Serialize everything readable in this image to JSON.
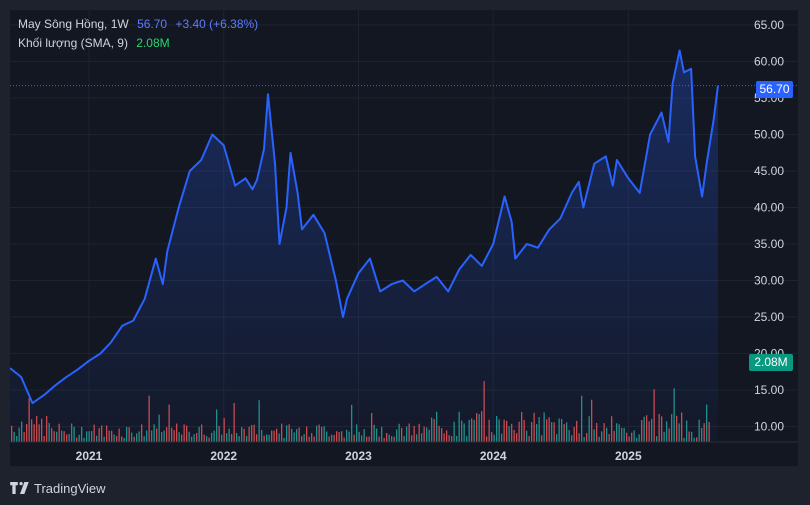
{
  "legend": {
    "symbol": "May Sông Hồng, 1W",
    "price": "56.70",
    "change": "+3.40 (+6.38%)",
    "volume_label": "Khối lượng (SMA, 9)",
    "volume_value": "2.08M"
  },
  "price_tag": "56.70",
  "volume_tag": "2.08M",
  "footer": {
    "brand": "TradingView",
    "logo_icon": "tradingview-logo-icon"
  },
  "colors": {
    "line": "#2962ff",
    "up_volume": "#26a69a",
    "down_volume": "#ef5350",
    "background": "#131722"
  },
  "chart_data": {
    "type": "line",
    "interval": "1W",
    "ylim": [
      7,
      67
    ],
    "y_ticks": [
      "10.00",
      "15.00",
      "20.00",
      "25.00",
      "30.00",
      "35.00",
      "40.00",
      "45.00",
      "50.00",
      "55.00",
      "60.00",
      "65.00"
    ],
    "x_ticks": [
      "2021",
      "2022",
      "2023",
      "2024",
      "2025"
    ],
    "series": [
      {
        "values": [
          {
            "x": "2020-06",
            "y": 18.0
          },
          {
            "x": "2020-07",
            "y": 16.8
          },
          {
            "x": "2020-08",
            "y": 13.2
          },
          {
            "x": "2020-09",
            "y": 14.3
          },
          {
            "x": "2020-10",
            "y": 15.6
          },
          {
            "x": "2020-11",
            "y": 16.8
          },
          {
            "x": "2020-12",
            "y": 17.8
          },
          {
            "x": "2021-01",
            "y": 19.0
          },
          {
            "x": "2021-02",
            "y": 20.0
          },
          {
            "x": "2021-03",
            "y": 21.5
          },
          {
            "x": "2021-04",
            "y": 23.8
          },
          {
            "x": "2021-05",
            "y": 24.5
          },
          {
            "x": "2021-06",
            "y": 27.5
          },
          {
            "x": "2021-07",
            "y": 33.0
          },
          {
            "x": "2021-07-20",
            "y": 29.5
          },
          {
            "x": "2021-08",
            "y": 34.0
          },
          {
            "x": "2021-09",
            "y": 40.0
          },
          {
            "x": "2021-10",
            "y": 45.0
          },
          {
            "x": "2021-11",
            "y": 46.5
          },
          {
            "x": "2021-12",
            "y": 50.0
          },
          {
            "x": "2022-01",
            "y": 48.5
          },
          {
            "x": "2022-02",
            "y": 43.0
          },
          {
            "x": "2022-03",
            "y": 44.0
          },
          {
            "x": "2022-03-20",
            "y": 42.5
          },
          {
            "x": "2022-04",
            "y": 43.8
          },
          {
            "x": "2022-04-20",
            "y": 48.0
          },
          {
            "x": "2022-05",
            "y": 55.5
          },
          {
            "x": "2022-05-20",
            "y": 46.0
          },
          {
            "x": "2022-06",
            "y": 35.0
          },
          {
            "x": "2022-06-20",
            "y": 40.0
          },
          {
            "x": "2022-07",
            "y": 47.5
          },
          {
            "x": "2022-07-20",
            "y": 42.0
          },
          {
            "x": "2022-08",
            "y": 37.0
          },
          {
            "x": "2022-09",
            "y": 39.0
          },
          {
            "x": "2022-10",
            "y": 36.5
          },
          {
            "x": "2022-11",
            "y": 30.0
          },
          {
            "x": "2022-11-20",
            "y": 25.0
          },
          {
            "x": "2022-12",
            "y": 27.5
          },
          {
            "x": "2023-01",
            "y": 31.0
          },
          {
            "x": "2023-02",
            "y": 33.0
          },
          {
            "x": "2023-03",
            "y": 28.5
          },
          {
            "x": "2023-04",
            "y": 29.5
          },
          {
            "x": "2023-05",
            "y": 30.0
          },
          {
            "x": "2023-06",
            "y": 28.5
          },
          {
            "x": "2023-07",
            "y": 29.5
          },
          {
            "x": "2023-08",
            "y": 30.5
          },
          {
            "x": "2023-09",
            "y": 28.5
          },
          {
            "x": "2023-10",
            "y": 31.5
          },
          {
            "x": "2023-11",
            "y": 33.5
          },
          {
            "x": "2023-12",
            "y": 32.0
          },
          {
            "x": "2024-01",
            "y": 35.0
          },
          {
            "x": "2024-01-20",
            "y": 39.0
          },
          {
            "x": "2024-02",
            "y": 41.5
          },
          {
            "x": "2024-02-20",
            "y": 38.0
          },
          {
            "x": "2024-03",
            "y": 33.0
          },
          {
            "x": "2024-04",
            "y": 35.0
          },
          {
            "x": "2024-05",
            "y": 34.5
          },
          {
            "x": "2024-06",
            "y": 37.0
          },
          {
            "x": "2024-07",
            "y": 38.5
          },
          {
            "x": "2024-08",
            "y": 42.0
          },
          {
            "x": "2024-08-20",
            "y": 43.5
          },
          {
            "x": "2024-09",
            "y": 40.0
          },
          {
            "x": "2024-10",
            "y": 46.0
          },
          {
            "x": "2024-11",
            "y": 47.0
          },
          {
            "x": "2024-11-20",
            "y": 43.0
          },
          {
            "x": "2024-12",
            "y": 46.5
          },
          {
            "x": "2025-01",
            "y": 44.0
          },
          {
            "x": "2025-02",
            "y": 42.0
          },
          {
            "x": "2025-03",
            "y": 50.0
          },
          {
            "x": "2025-04",
            "y": 53.0
          },
          {
            "x": "2025-04-20",
            "y": 49.0
          },
          {
            "x": "2025-05",
            "y": 57.0
          },
          {
            "x": "2025-05-20",
            "y": 61.5
          },
          {
            "x": "2025-06",
            "y": 58.5
          },
          {
            "x": "2025-06-20",
            "y": 59.0
          },
          {
            "x": "2025-07",
            "y": 47.0
          },
          {
            "x": "2025-07-20",
            "y": 41.5
          },
          {
            "x": "2025-08",
            "y": 46.0
          },
          {
            "x": "2025-08-20",
            "y": 52.0
          },
          {
            "x": "2025-09",
            "y": 56.7
          }
        ]
      }
    ]
  }
}
